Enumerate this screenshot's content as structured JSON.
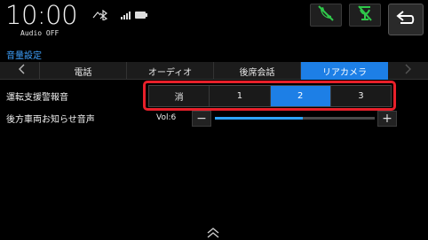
{
  "status": {
    "time": "10:00",
    "audio": "Audio OFF",
    "icons": [
      "bluetooth-icon",
      "signal-icon",
      "battery-icon"
    ]
  },
  "top_buttons": [
    "phone-disabled-icon",
    "mic-disabled-icon"
  ],
  "back_button": {
    "icon": "back-arrow-icon"
  },
  "section": {
    "title": "音量設定"
  },
  "tabs": [
    {
      "label": "電話",
      "active": false
    },
    {
      "label": "オーディオ",
      "active": false
    },
    {
      "label": "後席会話",
      "active": false
    },
    {
      "label": "リアカメラ",
      "active": true
    }
  ],
  "settings": {
    "warning_sound": {
      "label": "運転支援警報音",
      "options": [
        "消",
        "1",
        "2",
        "3"
      ],
      "selected": "2"
    },
    "rear_vehicle_notice": {
      "label": "後方車両お知らせ音声",
      "volume_text": "Vol:6",
      "volume_fraction": 0.55,
      "minus": "−",
      "plus": "+"
    }
  },
  "colors": {
    "accent": "#1d7fe6",
    "highlight": "#e8202a",
    "section_title": "#3fa2ff",
    "icon_green": "#2fc84a"
  }
}
